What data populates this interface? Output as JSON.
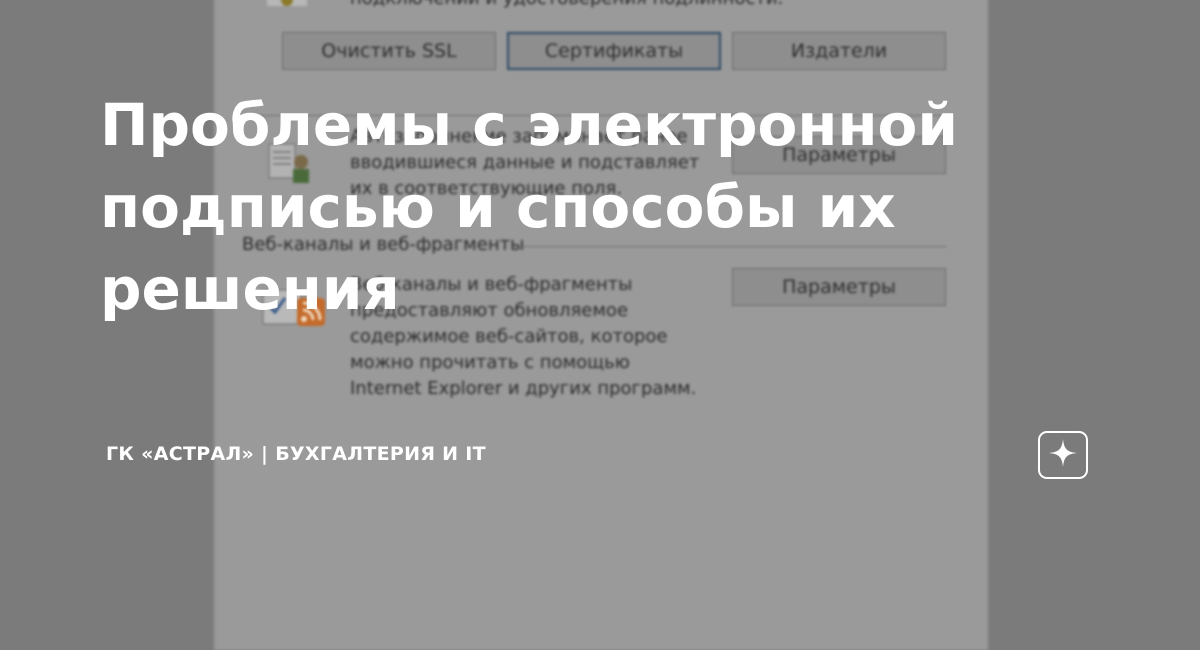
{
  "dialog": {
    "top_text": "подключений и удостоверения подлинности.",
    "buttons": {
      "clear_ssl": "Очистить SSL",
      "certificates": "Сертификаты",
      "publishers": "Издатели"
    },
    "autocomplete": {
      "description_lines": [
        "Автозаполнение запоминает ранее",
        "вводившиеся данные и подставляет",
        "их в соответствующие поля."
      ],
      "params_button": "Параметры"
    },
    "feeds": {
      "group_label": "Веб-каналы и веб-фрагменты",
      "description_lines": [
        "Веб-каналы и веб-фрагменты",
        "предоставляют обновляемое",
        "содержимое веб-сайтов, которое",
        "можно прочитать с помощью",
        "Internet Explorer и других программ."
      ],
      "params_button": "Параметры"
    }
  },
  "overlay": {
    "title": "Проблемы с электронной подписью и способы их решения",
    "source": "ГК «АСТРАЛ» | БУХГАЛТЕРИЯ И IT",
    "logo_icon": "sparkle-icon"
  },
  "colors": {
    "overlay_text": "#ffffff",
    "background": "#7b7b7b",
    "feed_icon": "#c46a2a"
  }
}
